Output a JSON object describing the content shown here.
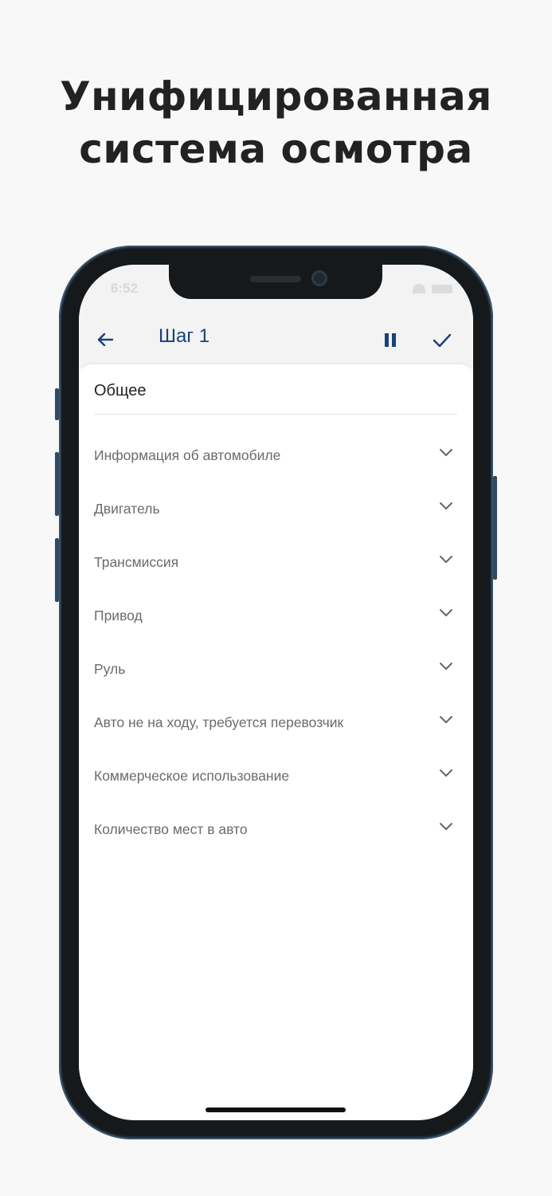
{
  "headline": {
    "line1": "Унифицированная",
    "line2": "система осмотра"
  },
  "status_bar": {
    "time": "6:52"
  },
  "app_bar": {
    "title": "Шаг 1",
    "icons": {
      "back": "arrow-left-icon",
      "pause": "pause-icon",
      "finish": "check-icon"
    },
    "accent_color": "#17417a"
  },
  "section": {
    "title": "Общее",
    "items": [
      {
        "label": "Информация об автомобиле"
      },
      {
        "label": "Двигатель"
      },
      {
        "label": "Трансмиссия"
      },
      {
        "label": "Привод"
      },
      {
        "label": "Руль"
      },
      {
        "label": "Авто не на ходу, требуется перевозчик"
      },
      {
        "label": "Коммерческое использование"
      },
      {
        "label": "Количество мест в авто"
      }
    ]
  }
}
